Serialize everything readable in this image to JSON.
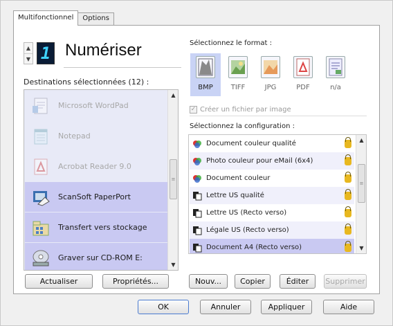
{
  "tabs": [
    "Multifonctionnel",
    "Options"
  ],
  "scanner": {
    "lcd_digit": "1",
    "title": "Numériser"
  },
  "destinations": {
    "label": "Destinations sélectionnées (12) :",
    "items": [
      {
        "label": "Microsoft WordPad",
        "icon": "wordpad-icon",
        "disabled": true
      },
      {
        "label": "Notepad",
        "icon": "notepad-icon",
        "disabled": true
      },
      {
        "label": "Acrobat Reader 9.0",
        "icon": "acrobat-icon",
        "disabled": true
      },
      {
        "label": "ScanSoft PaperPort",
        "icon": "paperport-icon",
        "selected": true
      },
      {
        "label": "Transfert vers stockage",
        "icon": "storage-icon",
        "selected": true
      },
      {
        "label": "Graver sur CD-ROM  E:",
        "icon": "cdrom-icon",
        "selected": true
      }
    ]
  },
  "left_buttons": {
    "refresh": "Actualiser",
    "properties": "Propriétés..."
  },
  "format": {
    "label": "Sélectionnez le format :",
    "items": [
      {
        "name": "BMP",
        "icon": "bmp-icon",
        "selected": true
      },
      {
        "name": "TIFF",
        "icon": "tiff-icon"
      },
      {
        "name": "JPG",
        "icon": "jpg-icon"
      },
      {
        "name": "PDF",
        "icon": "pdf-icon"
      },
      {
        "name": "n/a",
        "icon": "na-icon"
      }
    ]
  },
  "create_file_per_image": {
    "label": "Créer un fichier par image",
    "checked": true,
    "disabled": true
  },
  "configuration": {
    "label": "Sélectionnez la configuration :",
    "items": [
      {
        "label": "Document couleur qualité",
        "icon": "color-doc-icon"
      },
      {
        "label": "Photo couleur pour eMail (6x4)",
        "icon": "color-photo-icon"
      },
      {
        "label": "Document couleur",
        "icon": "color-doc-icon"
      },
      {
        "label": "Lettre US qualité",
        "icon": "bw-doc-icon"
      },
      {
        "label": "Lettre US (Recto verso)",
        "icon": "bw-doc-icon"
      },
      {
        "label": "Légale US (Recto verso)",
        "icon": "bw-doc-icon"
      },
      {
        "label": "Document A4 (Recto verso)",
        "icon": "bw-doc-icon",
        "selected": true
      }
    ]
  },
  "config_buttons": {
    "new": "Nouv...",
    "copy": "Copier",
    "edit": "Éditer",
    "delete": "Supprimer"
  },
  "footer_buttons": {
    "ok": "OK",
    "cancel": "Annuler",
    "apply": "Appliquer",
    "help": "Aide"
  },
  "colors": {
    "selection": "#c9c9f2",
    "lcd_bg": "#0a1c36",
    "lcd_fg": "#3fd3ff",
    "lock": "#e8b820"
  }
}
